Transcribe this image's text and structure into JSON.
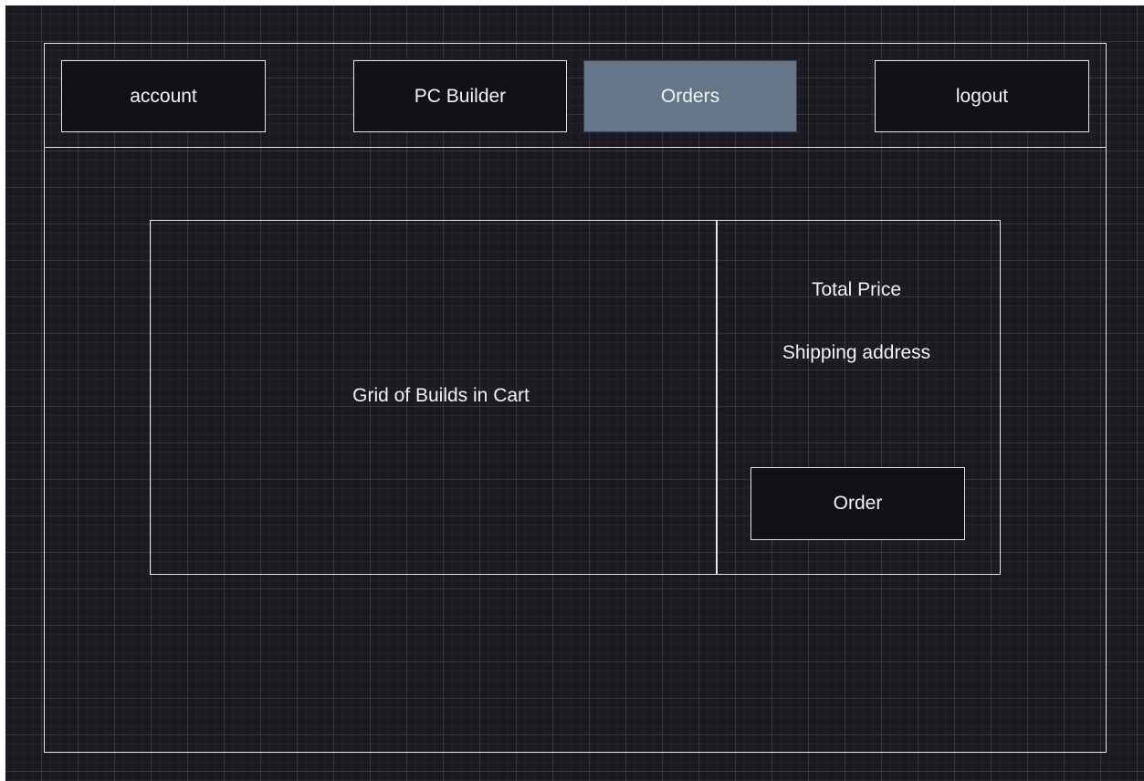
{
  "colors": {
    "canvas_background": "#1b1a20",
    "outline": "#e6e6e6",
    "button_fill": "#111016",
    "active_tab_fill": "#647687",
    "text": "#f2f2f2"
  },
  "nav": {
    "account": "account",
    "pc_builder": "PC Builder",
    "orders": "Orders",
    "logout": "logout",
    "active": "Orders"
  },
  "cart": {
    "grid_label": "Grid of Builds in Cart"
  },
  "summary": {
    "total_price": "Total Price",
    "shipping_address": "Shipping address",
    "order_button": "Order"
  }
}
